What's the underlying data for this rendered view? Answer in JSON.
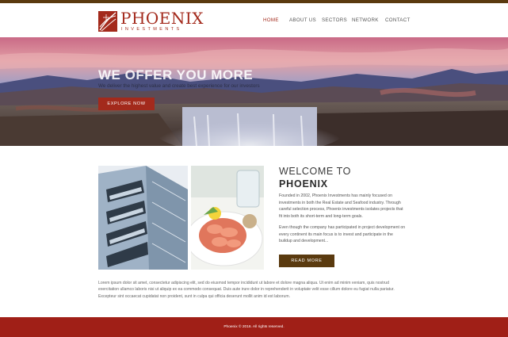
{
  "brand": {
    "name": "PHOENIX",
    "tagline": "INVESTMENTS",
    "primary_color": "#a32a1c",
    "secondary_color": "#5a3a0f"
  },
  "nav": {
    "items": [
      {
        "label": "HOME",
        "active": true
      },
      {
        "label": "ABOUT US",
        "active": false
      },
      {
        "label": "SECTORS",
        "active": false
      },
      {
        "label": "NETWORK",
        "active": false
      },
      {
        "label": "CONTACT",
        "active": false
      }
    ]
  },
  "hero": {
    "title": "WE OFFER YOU MORE",
    "subtitle": "We deliver the highest value and create best experience for our investors",
    "button": "EXPLORE NOW"
  },
  "about": {
    "heading_line1": "WELCOME TO",
    "heading_line2": "PHOENIX",
    "paragraph1": "Founded in 2002, Phoenix Investments has mainly focused on investments in both the Real Estate and Seafood industry. Through careful selection process, Phoenix investments isolates projects that fit into both its short-term and long-term goals.",
    "paragraph2": "Even though the company has participated in project development on every continent its main focus is to invest and participate in the buildup and development...",
    "button": "READ MORE",
    "images": [
      "building-photo",
      "seafood-photo"
    ]
  },
  "lorem": "Lorem ipsum dolor sit amet, consectetur adipiscing elit, sed do eiusmod tempor incididunt ut labore et dolore magna aliqua. Ut enim ad minim veniam, quis nostrud exercitation ullamco laboris nisi ut aliquip ex ea commodo consequat. Duis aute irure dolor in reprehenderit in voluptate velit esse cillum dolore eu fugiat nulla pariatur. Excepteur sint occaecat cupidatat non proident, sunt in culpa qui officia deserunt mollit anim id est laborum.",
  "footer": {
    "text": "Phoenix © 2016. All rights reserved."
  }
}
